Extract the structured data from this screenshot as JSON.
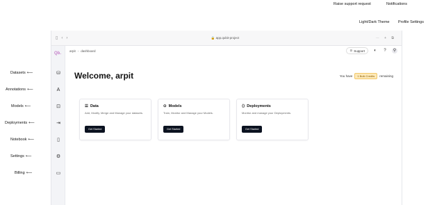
{
  "annotations_left": [
    {
      "label": "Datasets"
    },
    {
      "label": "Annotations"
    },
    {
      "label": "Models"
    },
    {
      "label": "Deployments"
    },
    {
      "label": "Notebook"
    },
    {
      "label": "Settings"
    },
    {
      "label": "Billing"
    }
  ],
  "annotations_top": {
    "raise_support": "Raise support request",
    "notifications": "Notifications",
    "theme": "Light/Dark Theme",
    "profile": "Profile Settings"
  },
  "browser": {
    "url": "app.qubit-project",
    "nav_back": "‹",
    "nav_forward": "›",
    "controls_right": "⋯ + ⧉"
  },
  "app": {
    "logo": "Qb.",
    "breadcrumb": [
      "arpit",
      "dashboard"
    ],
    "support_label": "Support",
    "welcome": "Welcome, arpit",
    "plan_prefix": "You have",
    "plan_badge": "1 Bulk Credits",
    "plan_suffix": "remaining"
  },
  "cards": [
    {
      "title": "Data",
      "desc": "Add, Modify, Merge and Manage your datasets.",
      "button": "Get Started",
      "icon": "database-icon",
      "glyph": "☰"
    },
    {
      "title": "Models",
      "desc": "Train, Monitor and Manage your Models.",
      "button": "Get Started",
      "icon": "models-icon",
      "glyph": "⊙"
    },
    {
      "title": "Deployments",
      "desc": "Monitor and manage your Deployments.",
      "button": "Get Started",
      "icon": "deploy-icon",
      "glyph": "⟨⟩"
    }
  ]
}
